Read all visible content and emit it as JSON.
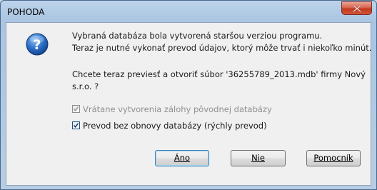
{
  "window": {
    "title": "POHODA"
  },
  "icons": {
    "dialog_icon": "question-icon",
    "close": "close-icon"
  },
  "message": {
    "line1": "Vybraná databáza bola vytvorená staršou verziou programu.",
    "line2": "Teraz je nutné vykonať prevod údajov, ktorý môže trvať i niekoľko minút.",
    "line3": "Chcete teraz previesť a otvoriť súbor '36255789_2013.mdb' firmy Nový",
    "line4": "s.r.o. ?"
  },
  "options": {
    "backup_label": "Vrátane vytvorenia zálohy pôvodnej databázy",
    "backup_checked": true,
    "backup_enabled": false,
    "no_restore_label": "Prevod bez obnovy databázy (rýchly prevod)",
    "no_restore_checked": true,
    "no_restore_enabled": true
  },
  "buttons": {
    "yes": "Áno",
    "no": "Nie",
    "help": "Pomocník"
  },
  "colors": {
    "close_button": "#c2381f",
    "icon_blue": "#2a6ec8",
    "default_button_border": "#3c7fb1"
  }
}
